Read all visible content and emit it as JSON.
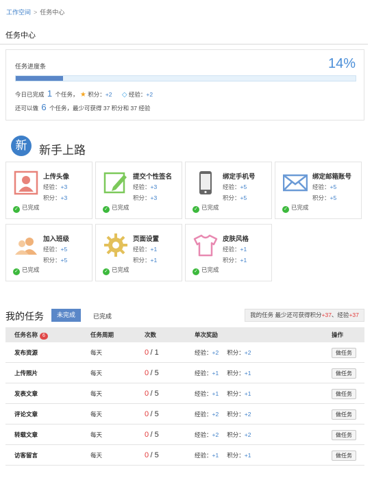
{
  "breadcrumb": {
    "home": "工作空间",
    "separator": ">",
    "current": "任务中心"
  },
  "page_title": "任务中心",
  "progress": {
    "label": "任务进度条",
    "percent_text": "14%",
    "fraction": 0.14,
    "today_prefix": "今日已完成",
    "today_count": "1",
    "today_suffix": "个任务，",
    "points_label": "积分：",
    "points_value": "+2",
    "exp_label": "经验：",
    "exp_value": "+2",
    "remain_prefix": "还可以做",
    "remain_count": "6",
    "remain_suffix": "个任务，最少可获得 37 积分和 37 经验"
  },
  "newbie": {
    "icon_char": "新",
    "title": "新手上路",
    "exp_label": "经验：",
    "points_label": "积分：",
    "done_label": "已完成",
    "tasks": [
      {
        "name": "上传头像",
        "exp": "+3",
        "points": "+3",
        "icon": "avatar-icon"
      },
      {
        "name": "提交个性签名",
        "exp": "+3",
        "points": "+3",
        "icon": "signature-icon"
      },
      {
        "name": "绑定手机号",
        "exp": "+5",
        "points": "+5",
        "icon": "phone-icon"
      },
      {
        "name": "绑定邮箱账号",
        "exp": "+5",
        "points": "+5",
        "icon": "mail-icon"
      },
      {
        "name": "加入班级",
        "exp": "+5",
        "points": "+5",
        "icon": "group-icon"
      },
      {
        "name": "页面设置",
        "exp": "+1",
        "points": "+1",
        "icon": "gear-icon"
      },
      {
        "name": "皮肤风格",
        "exp": "+1",
        "points": "+1",
        "icon": "shirt-icon"
      }
    ]
  },
  "my_tasks": {
    "title": "我的任务",
    "tab_incomplete": "未完成",
    "tab_complete": "已完成",
    "summary_prefix": "我的任务 最少还可获得积分",
    "summary_points": "+37",
    "summary_mid": "、经验",
    "summary_exp": "+37",
    "columns": {
      "name": "任务名称",
      "badge": "6",
      "period": "任务周期",
      "count": "次数",
      "reward": "单次奖励",
      "action": "操作"
    },
    "exp_label": "经验：",
    "points_label": "积分：",
    "button_label": "做任务",
    "rows": [
      {
        "name": "发布资源",
        "period": "每天",
        "done": "0",
        "total": "/ 1",
        "exp": "+2",
        "points": "+2"
      },
      {
        "name": "上传照片",
        "period": "每天",
        "done": "0",
        "total": "/ 5",
        "exp": "+1",
        "points": "+1"
      },
      {
        "name": "发表文章",
        "period": "每天",
        "done": "0",
        "total": "/ 5",
        "exp": "+1",
        "points": "+1"
      },
      {
        "name": "评论文章",
        "period": "每天",
        "done": "0",
        "total": "/ 5",
        "exp": "+2",
        "points": "+2"
      },
      {
        "name": "转载文章",
        "period": "每天",
        "done": "0",
        "total": "/ 5",
        "exp": "+2",
        "points": "+2"
      },
      {
        "name": "访客留言",
        "period": "每天",
        "done": "0",
        "total": "/ 5",
        "exp": "+1",
        "points": "+1"
      }
    ]
  },
  "colors": {
    "accent": "#5a87c8",
    "link": "#3d7fc9",
    "red": "#e23b3b",
    "done_green": "#3cb93c"
  }
}
